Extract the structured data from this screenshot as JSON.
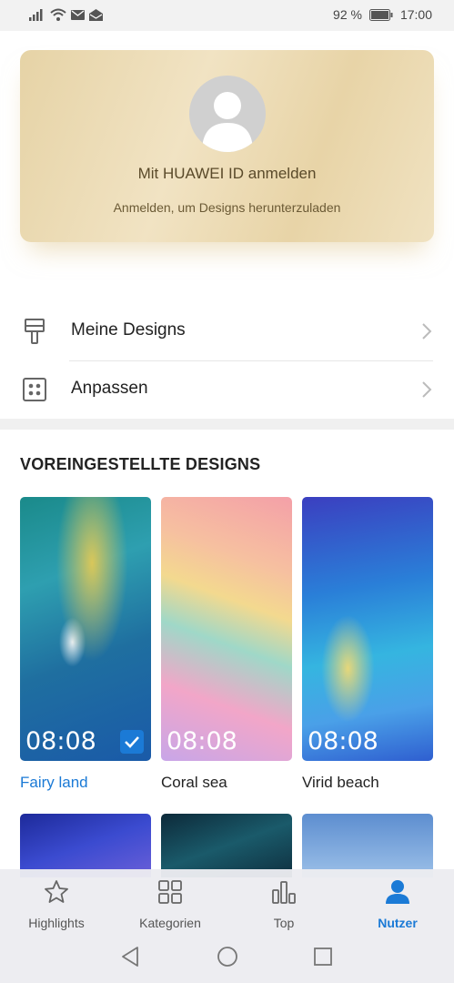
{
  "status_bar": {
    "battery_percent": "92 %",
    "time": "17:00"
  },
  "account_card": {
    "title": "Mit HUAWEI ID anmelden",
    "subtitle": "Anmelden, um Designs herunterzuladen",
    "avatar_icon": "default-user-icon"
  },
  "menu": [
    {
      "label": "Meine Designs",
      "icon": "paintbrush-icon"
    },
    {
      "label": "Anpassen",
      "icon": "grid-dots-icon"
    }
  ],
  "section": {
    "title": "VOREINGESTELLTE DESIGNS"
  },
  "themes": [
    {
      "name": "Fairy land",
      "time": "08:08",
      "selected": true
    },
    {
      "name": "Coral sea",
      "time": "08:08",
      "selected": false
    },
    {
      "name": "Virid beach",
      "time": "08:08",
      "selected": false
    }
  ],
  "tabs": [
    {
      "label": "Highlights",
      "icon": "star-icon"
    },
    {
      "label": "Kategorien",
      "icon": "grid-icon"
    },
    {
      "label": "Top",
      "icon": "bar-chart-icon"
    },
    {
      "label": "Nutzer",
      "icon": "user-icon"
    }
  ],
  "accent_color": "#1b7ad6"
}
